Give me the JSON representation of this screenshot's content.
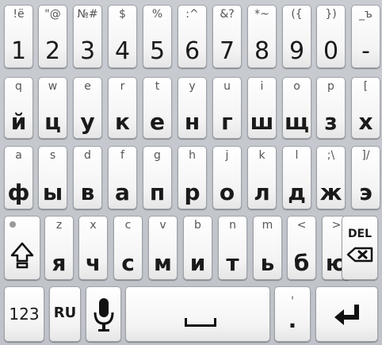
{
  "keyboard": {
    "number_row": [
      {
        "alt": "!ё",
        "main": "1"
      },
      {
        "alt": "\"@",
        "main": "2"
      },
      {
        "alt": "№#",
        "main": "3"
      },
      {
        "alt": "$",
        "main": "4"
      },
      {
        "alt": "%",
        "main": "5"
      },
      {
        "alt": ":^",
        "main": "6"
      },
      {
        "alt": "&?",
        "main": "7"
      },
      {
        "alt": "*~",
        "main": "8"
      },
      {
        "alt": "({",
        "main": "9"
      },
      {
        "alt": "})",
        "main": "0"
      },
      {
        "alt": "_ъ",
        "main": "-"
      }
    ],
    "row1": [
      {
        "alt": "q",
        "main": "й"
      },
      {
        "alt": "w",
        "main": "ц"
      },
      {
        "alt": "e",
        "main": "у"
      },
      {
        "alt": "r",
        "main": "к"
      },
      {
        "alt": "t",
        "main": "е"
      },
      {
        "alt": "y",
        "main": "н"
      },
      {
        "alt": "u",
        "main": "г"
      },
      {
        "alt": "i",
        "main": "ш"
      },
      {
        "alt": "o",
        "main": "щ"
      },
      {
        "alt": "p",
        "main": "з"
      },
      {
        "alt": "[",
        "main": "х"
      }
    ],
    "row2": [
      {
        "alt": "a",
        "main": "ф"
      },
      {
        "alt": "s",
        "main": "ы"
      },
      {
        "alt": "d",
        "main": "в"
      },
      {
        "alt": "f",
        "main": "а"
      },
      {
        "alt": "g",
        "main": "п"
      },
      {
        "alt": "h",
        "main": "р"
      },
      {
        "alt": "j",
        "main": "о"
      },
      {
        "alt": "k",
        "main": "л"
      },
      {
        "alt": "l",
        "main": "д"
      },
      {
        "alt": ";\\",
        "main": "ж"
      },
      {
        "alt": "]/",
        "main": "э"
      }
    ],
    "row3_letters": [
      {
        "alt": "z",
        "main": "я"
      },
      {
        "alt": "x",
        "main": "ч"
      },
      {
        "alt": "c",
        "main": "с"
      },
      {
        "alt": "v",
        "main": "м"
      },
      {
        "alt": "b",
        "main": "и"
      },
      {
        "alt": "n",
        "main": "т"
      },
      {
        "alt": "m",
        "main": "ь"
      },
      {
        "alt": "<",
        "main": "б"
      },
      {
        "alt": ">",
        "main": "ю"
      }
    ],
    "shift_icon": "shift-icon",
    "del_label": "DEL",
    "bottom": {
      "symbols_label": "123",
      "language_label": "RU",
      "mic_icon": "microphone-icon",
      "space_icon": "space-icon",
      "period_alt": "'",
      "period_main": ".",
      "enter_icon": "enter-icon"
    }
  }
}
